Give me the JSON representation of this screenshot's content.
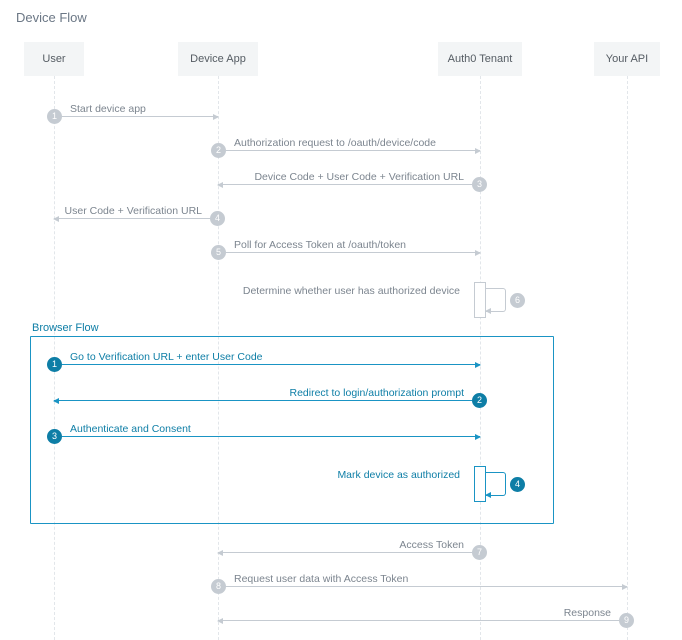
{
  "title": "Device Flow",
  "browser_flow_title": "Browser Flow",
  "lanes": {
    "user": "User",
    "device": "Device App",
    "tenant": "Auth0 Tenant",
    "api": "Your API"
  },
  "messages": {
    "m1": "Start device app",
    "m2": "Authorization request to /oauth/device/code",
    "m3": "Device Code + User Code + Verification URL",
    "m4": "User Code + Verification URL",
    "m5": "Poll for Access Token at /oauth/token",
    "m6": "Determine whether user has authorized device",
    "b1": "Go to Verification URL + enter User Code",
    "b2": "Redirect to login/authorization prompt",
    "b3": "Authenticate and Consent",
    "b4": "Mark device as authorized",
    "m7": "Access Token",
    "m8": "Request user data with Access Token",
    "m9": "Response"
  },
  "chart_data": {
    "type": "sequence",
    "title": "Device Flow",
    "participants": [
      "User",
      "Device App",
      "Auth0 Tenant",
      "Your API"
    ],
    "steps": [
      {
        "n": 1,
        "from": "User",
        "to": "Device App",
        "text": "Start device app"
      },
      {
        "n": 2,
        "from": "Device App",
        "to": "Auth0 Tenant",
        "text": "Authorization request to /oauth/device/code"
      },
      {
        "n": 3,
        "from": "Auth0 Tenant",
        "to": "Device App",
        "text": "Device Code + User Code + Verification URL"
      },
      {
        "n": 4,
        "from": "Device App",
        "to": "User",
        "text": "User Code + Verification URL"
      },
      {
        "n": 5,
        "from": "Device App",
        "to": "Auth0 Tenant",
        "text": "Poll for Access Token at /oauth/token"
      },
      {
        "n": 6,
        "from": "Auth0 Tenant",
        "to": "Auth0 Tenant",
        "text": "Determine whether user has authorized device",
        "self": true
      }
    ],
    "browser_flow": {
      "title": "Browser Flow",
      "steps": [
        {
          "n": 1,
          "from": "User",
          "to": "Auth0 Tenant",
          "text": "Go to Verification URL + enter User Code"
        },
        {
          "n": 2,
          "from": "Auth0 Tenant",
          "to": "User",
          "text": "Redirect to login/authorization prompt"
        },
        {
          "n": 3,
          "from": "User",
          "to": "Auth0 Tenant",
          "text": "Authenticate and Consent"
        },
        {
          "n": 4,
          "from": "Auth0 Tenant",
          "to": "Auth0 Tenant",
          "text": "Mark device as authorized",
          "self": true
        }
      ]
    },
    "post_steps": [
      {
        "n": 7,
        "from": "Auth0 Tenant",
        "to": "Device App",
        "text": "Access Token"
      },
      {
        "n": 8,
        "from": "Device App",
        "to": "Your API",
        "text": "Request user data with Access Token"
      },
      {
        "n": 9,
        "from": "Your API",
        "to": "Device App",
        "text": "Response"
      }
    ]
  }
}
